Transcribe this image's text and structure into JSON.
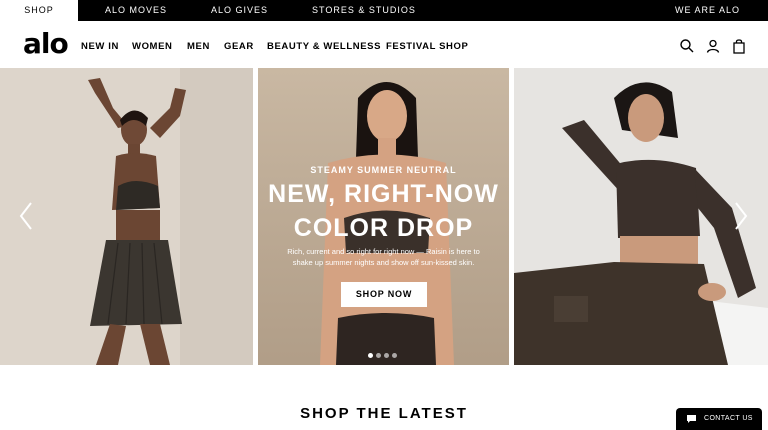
{
  "topbar": {
    "tabs": [
      {
        "label": "SHOP",
        "active": true
      },
      {
        "label": "ALO MOVES"
      },
      {
        "label": "ALO GIVES"
      },
      {
        "label": "STORES & STUDIOS"
      }
    ],
    "right_link": "WE ARE ALO"
  },
  "brand": {
    "logo_text": "alo"
  },
  "nav": {
    "items": [
      "NEW IN",
      "WOMEN",
      "MEN",
      "GEAR",
      "BEAUTY & WELLNESS",
      "FESTIVAL SHOP"
    ],
    "icons": [
      "search-icon",
      "account-icon",
      "shopping-bag-icon"
    ]
  },
  "hero": {
    "eyebrow": "STEAMY SUMMER NEUTRAL",
    "headline_line1": "NEW, RIGHT-NOW",
    "headline_line2": "COLOR DROP",
    "subtext": "Rich, current and so right for right now — Raisin is here to shake up summer nights and show off sun-kissed skin.",
    "cta": "SHOP NOW",
    "slide_count": 4,
    "active_slide": 1
  },
  "sections": {
    "latest_title": "SHOP THE LATEST"
  },
  "contact": {
    "label": "CONTACT US"
  },
  "colors": {
    "accent": "#000000",
    "topbar_bg": "#000000"
  }
}
